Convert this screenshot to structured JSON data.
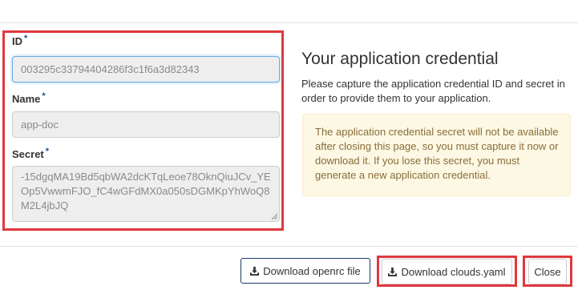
{
  "form": {
    "id": {
      "label": "ID",
      "required_mark": "*",
      "value": "003295c33794404286f3c1f6a3d82343"
    },
    "name": {
      "label": "Name",
      "required_mark": "*",
      "value": "app-doc"
    },
    "secret": {
      "label": "Secret",
      "required_mark": "*",
      "value": "-15dgqMA19Bd5qbWA2dcKTqLeoe78OknQiuJCv_YEOp5VwwmFJO_fC4wGFdMX0a050sDGMKpYhWoQ8M2L4jbJQ"
    }
  },
  "info": {
    "title": "Your application credential",
    "description": "Please capture the application credential ID and secret in order to provide them to your application.",
    "warning": "The application credential secret will not be available after closing this page, so you must capture it now or download it. If you lose this secret, you must generate a new application credential."
  },
  "footer": {
    "openrc_label": "Download openrc file",
    "clouds_label": "Download clouds.yaml",
    "close_label": "Close"
  },
  "colors": {
    "highlight_border": "#e0383e",
    "required_star": "#1a4f91",
    "warning_bg": "#fcf8e3",
    "warning_text": "#8a6d3b"
  },
  "icons": {
    "download": "download-icon",
    "resize": "resize-grip-icon"
  }
}
